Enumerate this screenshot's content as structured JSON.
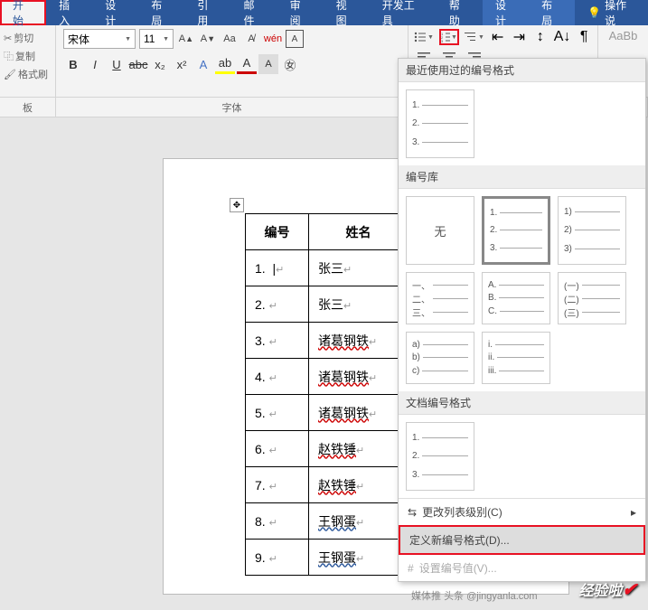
{
  "ribbon": {
    "tabs": [
      "开始",
      "插入",
      "设计",
      "布局",
      "引用",
      "邮件",
      "审阅",
      "视图",
      "开发工具",
      "帮助",
      "设计",
      "布局"
    ],
    "tell_me": "操作说"
  },
  "clipboard": {
    "cut": "剪切",
    "copy": "复制",
    "format_painter": "格式刷",
    "group_label": "板"
  },
  "font": {
    "family": "宋体",
    "size": "11",
    "group_label": "字体"
  },
  "styles": {
    "placeholder": "AaBb"
  },
  "labels": {
    "group_clipboard_sub": "板"
  },
  "table": {
    "headers": [
      "编号",
      "姓名"
    ],
    "rows": [
      {
        "num": "1.",
        "name": "张三"
      },
      {
        "num": "2.",
        "name": "张三"
      },
      {
        "num": "3.",
        "name": "诸葛钢铁"
      },
      {
        "num": "4.",
        "name": "诸葛钢铁"
      },
      {
        "num": "5.",
        "name": "诸葛钢铁"
      },
      {
        "num": "6.",
        "name": "赵铁锤"
      },
      {
        "num": "7.",
        "name": "赵铁锤"
      },
      {
        "num": "8.",
        "name": "王钢蛋"
      },
      {
        "num": "9.",
        "name": "王钢蛋"
      }
    ]
  },
  "numbering_dropdown": {
    "recent_title": "最近使用过的编号格式",
    "recent": [
      "1.",
      "2.",
      "3."
    ],
    "library_title": "编号库",
    "none": "无",
    "lib": [
      [
        "1.",
        "2.",
        "3."
      ],
      [
        "1)",
        "2)",
        "3)"
      ],
      [
        "一、",
        "二、",
        "三、"
      ],
      [
        "A.",
        "B.",
        "C."
      ],
      [
        "(一)",
        "(二)",
        "(三)"
      ],
      [
        "a)",
        "b)",
        "c)"
      ],
      [
        "i.",
        "ii.",
        "iii."
      ]
    ],
    "doc_formats_title": "文档编号格式",
    "doc_formats": [
      "1.",
      "2.",
      "3."
    ],
    "change_level": "更改列表级别(C)",
    "define_new": "定义新编号格式(D)...",
    "set_value": "设置编号值(V)..."
  },
  "footer": {
    "media": "媒体推",
    "headline": "头条",
    "at": "@jingyanla.com"
  },
  "watermark": {
    "text": "经验啦"
  }
}
